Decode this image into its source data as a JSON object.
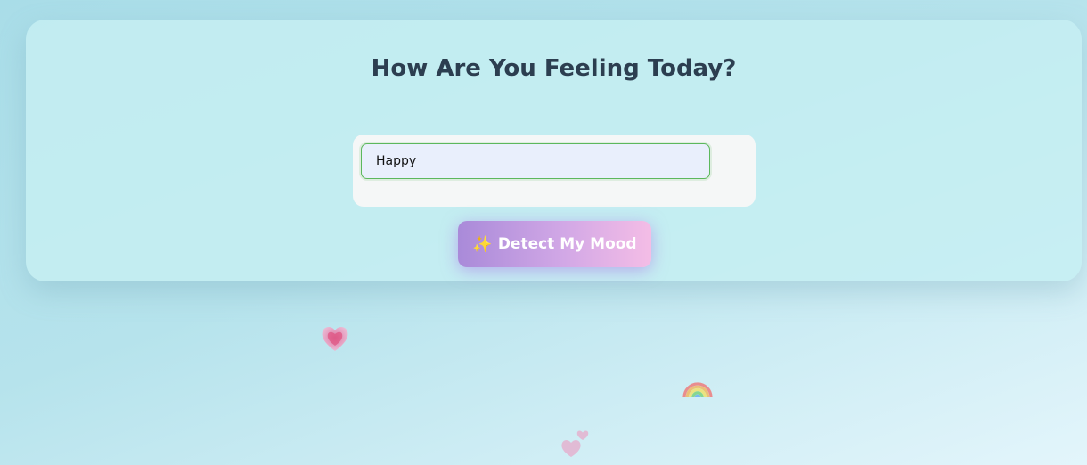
{
  "card": {
    "title": "How Are You Feeling Today?"
  },
  "mood_input": {
    "value": "Happy"
  },
  "detect_button": {
    "icon": "sparkles-icon",
    "icon_glyph": "✨",
    "label": "Detect My Mood"
  },
  "decorations": [
    "glowing-heart-icon",
    "rainbow-icon",
    "two-hearts-icon"
  ],
  "colors": {
    "title": "#2c3e50",
    "input_border": "#5cb85c",
    "button_start": "#a98ad9",
    "button_end": "#f4bde6"
  }
}
